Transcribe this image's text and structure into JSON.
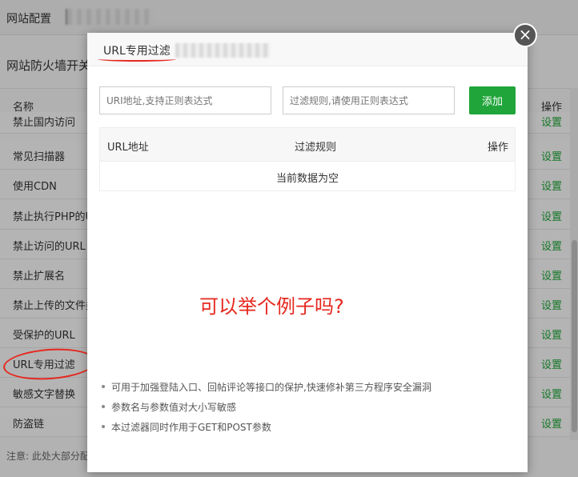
{
  "background": {
    "topbar_title": "网站配置",
    "firewall_title": "网站防火墙开关",
    "table_header": {
      "name": "名称",
      "action": "操作"
    },
    "rows": [
      {
        "name": "禁止国内访问",
        "action": "设置"
      },
      {
        "name": "常见扫描器",
        "action": "设置"
      },
      {
        "name": "使用CDN",
        "action": "设置"
      },
      {
        "name": "禁止执行PHP的URL",
        "action": "设置"
      },
      {
        "name": "禁止访问的URL",
        "action": "设置"
      },
      {
        "name": "禁止扩展名",
        "action": "设置"
      },
      {
        "name": "禁止上传的文件类型",
        "action": "设置"
      },
      {
        "name": "受保护的URL",
        "action": "设置"
      },
      {
        "name": "URL专用过滤",
        "action": "设置"
      },
      {
        "name": "敏感文字替换",
        "action": "设置"
      },
      {
        "name": "防盗链",
        "action": "设置"
      }
    ],
    "note": "注意: 此处大部分配置"
  },
  "modal": {
    "title": "URL专用过滤",
    "url_input": {
      "placeholder": "URI地址,支持正则表达式",
      "value": ""
    },
    "rule_input": {
      "placeholder": "过滤规则,请使用正则表达式",
      "value": ""
    },
    "add_label": "添加",
    "table": {
      "headers": [
        "URL地址",
        "过滤规则",
        "操作"
      ],
      "empty_text": "当前数据为空"
    },
    "tips": [
      "可用于加强登陆入口、回帖评论等接口的保护,快速修补第三方程序安全漏洞",
      "参数名与参数值对大小写敏感",
      "本过滤器同时作用于GET和POST参数"
    ]
  },
  "annotation": {
    "question": "可以举个例子吗?"
  },
  "colors": {
    "accent": "#20a53a",
    "annotation": "#e6281f"
  }
}
